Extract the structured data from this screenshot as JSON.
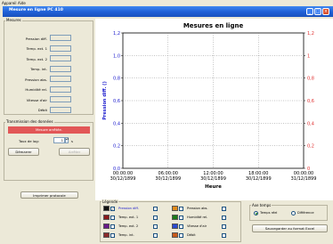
{
  "menubar": {
    "items": [
      "Appareil",
      "Aide"
    ]
  },
  "window": {
    "title": "Mesure en ligne PC 410"
  },
  "measures": {
    "title": "Mesures",
    "rows": [
      {
        "label": "Pression diff.",
        "value": ""
      },
      {
        "label": "Temp. ext. 1",
        "value": ""
      },
      {
        "label": "Temp. ext. 2",
        "value": ""
      },
      {
        "label": "Temp. int.",
        "value": ""
      },
      {
        "label": "Pression abs.",
        "value": ""
      },
      {
        "label": "Humidité rel.",
        "value": ""
      },
      {
        "label": "Vitesse d'air",
        "value": ""
      },
      {
        "label": "Débit",
        "value": ""
      }
    ]
  },
  "transmission": {
    "title": "Transmission des données",
    "status": "Mesure arrêtée.",
    "rate_label": "Taux de log:",
    "rate_value": "1",
    "rate_unit": "s",
    "start_label": "Démarrer",
    "stop_label": "Arrêter"
  },
  "print_label": "Imprimer protocole",
  "chart_data": {
    "type": "line",
    "title": "Mesures en ligne",
    "xlabel": "Heure",
    "ylabel": "Pression diff. ()",
    "ylim": [
      0,
      1.2
    ],
    "y_ticks": [
      "0,0",
      "0,2",
      "0,4",
      "0,6",
      "0,8",
      "1,0",
      "1,2"
    ],
    "y2_ticks": [
      "0",
      "0,2",
      "0,4",
      "0,6",
      "0,8",
      "1",
      "1,2"
    ],
    "x_ticks": [
      {
        "time": "00:00:00",
        "date": "30/12/1899"
      },
      {
        "time": "06:00:00",
        "date": "30/12/1899"
      },
      {
        "time": "12:00:00",
        "date": "30/12/1899"
      },
      {
        "time": "18:00:00",
        "date": "30/12/1899"
      },
      {
        "time": "00:00:00",
        "date": "31/12/1899"
      }
    ],
    "series": [],
    "grid": true,
    "left_axis_color": "#1a1acd",
    "right_axis_color": "#e03030"
  },
  "legend": {
    "title": "Légende",
    "left_items": [
      {
        "label": "Pression diff.",
        "color": "#111111",
        "checked": true,
        "highlight": true
      },
      {
        "label": "Temp. ext. 1",
        "color": "#8b1a1a",
        "checked": false
      },
      {
        "label": "Temp. ext. 2",
        "color": "#6a1a8a",
        "checked": false
      },
      {
        "label": "Temp. int.",
        "color": "#8b2a2a",
        "checked": false
      }
    ],
    "right_items": [
      {
        "label": "Pression abs.",
        "color": "#e08a1a",
        "checked": false
      },
      {
        "label": "Humidité rel.",
        "color": "#1a7a1a",
        "checked": false
      },
      {
        "label": "Vitesse d'air",
        "color": "#2a4ad0",
        "checked": false
      },
      {
        "label": "Débit",
        "color": "#c85a1a",
        "checked": false
      }
    ]
  },
  "axis_time": {
    "title": "Axe temps",
    "real_label": "Temps réel",
    "diff_label": "Différence",
    "selected": "real",
    "export_label": "Sauvegarder au format Excel"
  }
}
